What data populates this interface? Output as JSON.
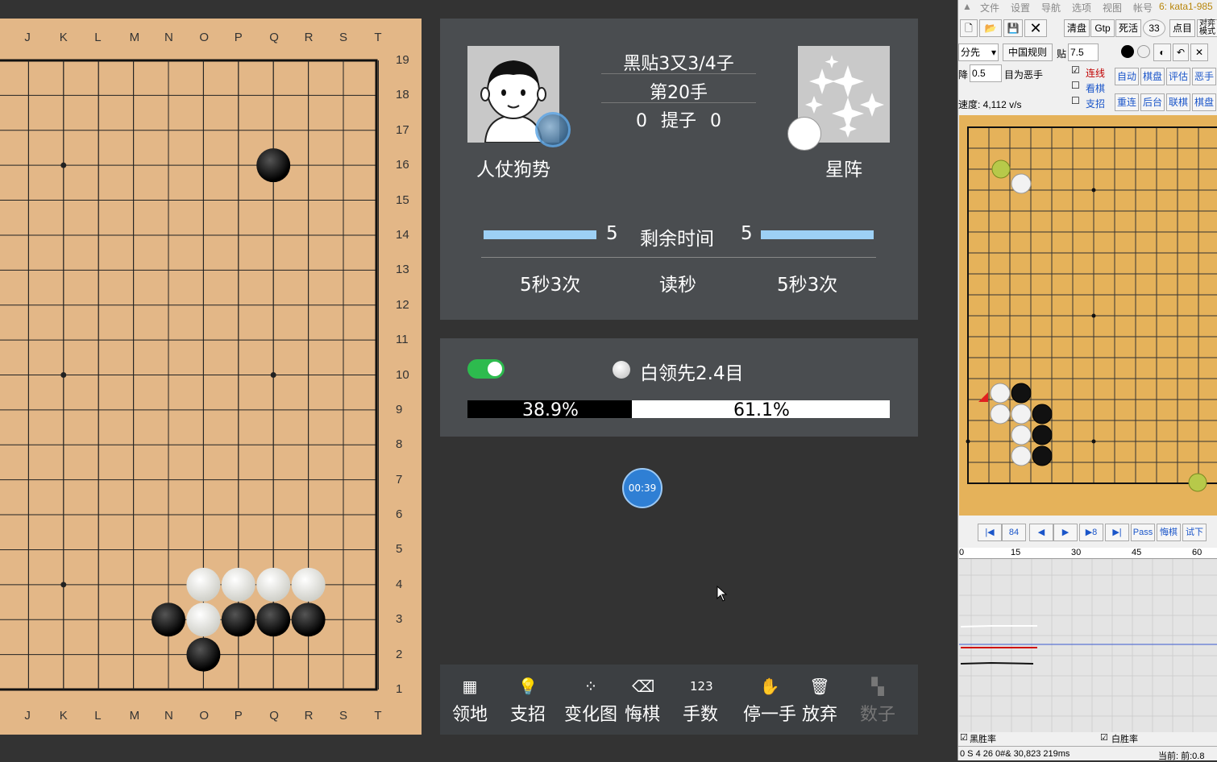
{
  "board": {
    "col_labels": [
      "J",
      "K",
      "L",
      "M",
      "N",
      "O",
      "P",
      "Q",
      "R",
      "S",
      "T"
    ],
    "row_labels": [
      "19",
      "18",
      "17",
      "16",
      "15",
      "14",
      "13",
      "12",
      "11",
      "10",
      "9",
      "8",
      "7",
      "6",
      "5",
      "4",
      "3",
      "2",
      "1"
    ],
    "stones": [
      {
        "col": "Q",
        "row": 16,
        "color": "black"
      },
      {
        "col": "O",
        "row": 4,
        "color": "white"
      },
      {
        "col": "P",
        "row": 4,
        "color": "white"
      },
      {
        "col": "Q",
        "row": 4,
        "color": "white"
      },
      {
        "col": "R",
        "row": 4,
        "color": "white"
      },
      {
        "col": "N",
        "row": 3,
        "color": "black"
      },
      {
        "col": "O",
        "row": 3,
        "color": "white"
      },
      {
        "col": "P",
        "row": 3,
        "color": "black"
      },
      {
        "col": "Q",
        "row": 3,
        "color": "black"
      },
      {
        "col": "R",
        "row": 3,
        "color": "black"
      },
      {
        "col": "O",
        "row": 2,
        "color": "black"
      }
    ],
    "colors": {
      "board": "#e3b787",
      "line": "#222222"
    }
  },
  "info": {
    "komi_text": "黑贴3又3/4子",
    "move_text": "第20手",
    "captures_left": "0",
    "captures_label": "提子",
    "captures_right": "0",
    "player_left": "人仗狗势",
    "player_right": "星阵",
    "time_left": "5",
    "time_label": "剩余时间",
    "time_right": "5",
    "byoyomi_left": "5秒3次",
    "byoyomi_label": "读秒",
    "byoyomi_right": "5秒3次"
  },
  "eval": {
    "toggle_on": true,
    "lead_text": "白领先2.4目",
    "black_rate": "38.9%",
    "white_rate": "61.1%",
    "black_fraction": 0.389
  },
  "timer": "00:39",
  "toolbar": [
    {
      "label": "领地",
      "icon": "territory-icon",
      "enabled": true
    },
    {
      "label": "支招",
      "icon": "bulb-icon",
      "enabled": true
    },
    {
      "label": "变化图",
      "icon": "variation-icon",
      "enabled": true
    },
    {
      "label": "悔棋",
      "icon": "undo-icon",
      "enabled": true
    },
    {
      "label": "手数",
      "icon": "numbers-icon",
      "glyph": "123",
      "enabled": true
    },
    {
      "label": "停一手",
      "icon": "hand-icon",
      "enabled": true
    },
    {
      "label": "放弃",
      "icon": "trash-icon",
      "enabled": true
    },
    {
      "label": "数子",
      "icon": "count-icon",
      "enabled": false
    }
  ],
  "right_app": {
    "menu": [
      "文件",
      "设置",
      "导航",
      "选项",
      "视图",
      "帐号"
    ],
    "engine": "6: kata1-985",
    "tool_buttons": [
      "清盘",
      "Gtp",
      "死活",
      "点目",
      "对弈模式"
    ],
    "handicap_select": "分先",
    "rules_button": "中国规则",
    "komi_label": "贴",
    "komi_value": "7.5",
    "drop_label": "降",
    "drop_value": "0.5",
    "bad_label": "目为恶手",
    "checks": [
      {
        "label": "连线",
        "checked": true,
        "color": "#c00000"
      },
      {
        "label": "看棋",
        "checked": false,
        "color": "#1a55c9"
      },
      {
        "label": "支招",
        "checked": false,
        "color": "#1a55c9"
      }
    ],
    "side_buttons": [
      "自动",
      "棋盘",
      "评估",
      "恶手",
      "重连",
      "后台",
      "联棋",
      "棋盘"
    ],
    "speed": "速度: 4,112 v/s",
    "nav": [
      "|◀",
      "84",
      "◀",
      "▶",
      "▶8",
      "▶|",
      "Pass",
      "悔棋",
      "试下"
    ],
    "graph_ticks": [
      "0",
      "15",
      "30",
      "45",
      "60"
    ],
    "bottom_checks": [
      "黑胜率",
      "白胜率"
    ],
    "status_left": "0 S  4  26  0#&  30,823  219ms",
    "status_right": "当前: 前:0.8"
  }
}
